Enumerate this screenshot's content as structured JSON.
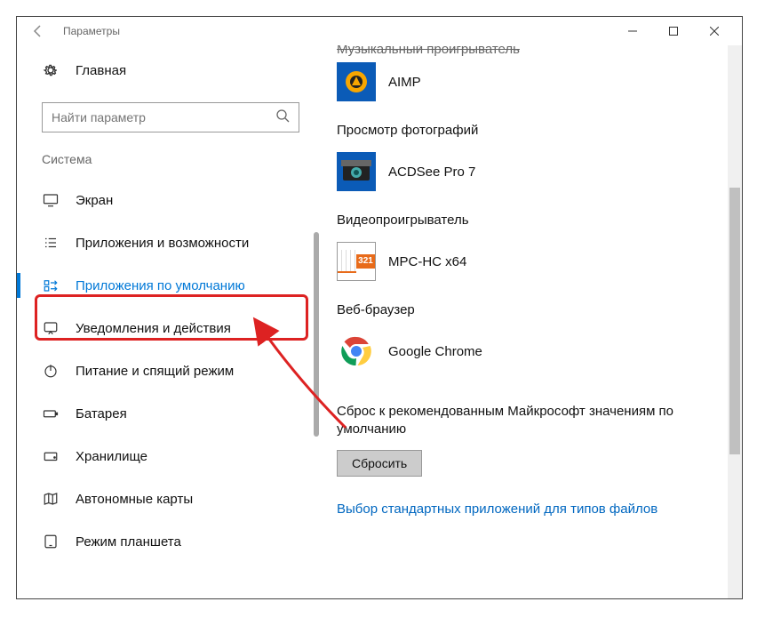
{
  "window": {
    "title": "Параметры"
  },
  "sidebar": {
    "home": "Главная",
    "search_placeholder": "Найти параметр",
    "group": "Система",
    "items": [
      {
        "label": "Экран"
      },
      {
        "label": "Приложения и возможности"
      },
      {
        "label": "Приложения по умолчанию"
      },
      {
        "label": "Уведомления и действия"
      },
      {
        "label": "Питание и спящий режим"
      },
      {
        "label": "Батарея"
      },
      {
        "label": "Хранилище"
      },
      {
        "label": "Автономные карты"
      },
      {
        "label": "Режим планшета"
      }
    ]
  },
  "main": {
    "truncated_header": "Музыкальный проигрыватель",
    "sections": [
      {
        "title": "",
        "app": "AIMP"
      },
      {
        "title": "Просмотр фотографий",
        "app": "ACDSee Pro 7"
      },
      {
        "title": "Видеопроигрыватель",
        "app": "MPC-HC x64"
      },
      {
        "title": "Веб-браузер",
        "app": "Google Chrome"
      }
    ],
    "reset_text": "Сброс к рекомендованным Майкрософт значениям по умолчанию",
    "reset_button": "Сбросить",
    "link": "Выбор стандартных приложений для типов файлов"
  }
}
